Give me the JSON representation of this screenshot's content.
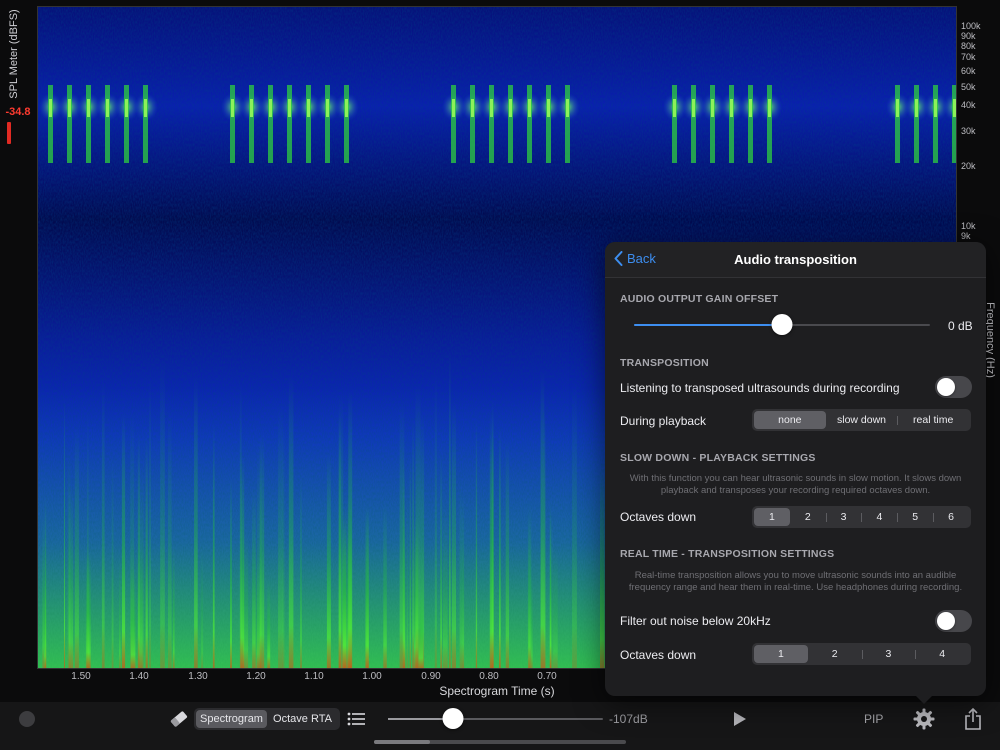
{
  "spl_meter": {
    "title": "SPL Meter (dBFS)",
    "value": "-34.8",
    "segments_total": 75,
    "segments_lit": 45,
    "lit_color": "#e12a23"
  },
  "spectrogram": {
    "frequency_axis": {
      "title": "Frequency (Hz)",
      "ticks": [
        "100k",
        "90k",
        "80k",
        "70k",
        "60k",
        "50k",
        "40k",
        "30k",
        "20k",
        "10k",
        "9k"
      ]
    },
    "time_axis": {
      "title": "Spectrogram Time (s)",
      "ticks": [
        "1.50",
        "1.40",
        "1.30",
        "1.20",
        "1.10",
        "1.00",
        "0.90",
        "0.80",
        "0.70"
      ]
    }
  },
  "toolbar": {
    "view_options": [
      "Spectrogram",
      "Octave RTA"
    ],
    "selected_view": "Spectrogram",
    "gain_value": "-107dB",
    "gain_level": 0.3,
    "pip_label": "PIP"
  },
  "popover": {
    "back_label": "Back",
    "title": "Audio transposition",
    "output_gain": {
      "header": "AUDIO OUTPUT GAIN OFFSET",
      "value": "0 dB",
      "level": 0.5
    },
    "transposition": {
      "header": "TRANSPOSITION",
      "listen_label": "Listening to transposed ultrasounds during recording",
      "listen_on": false,
      "playback_label": "During playback",
      "playback_options": [
        "none",
        "slow down",
        "real time"
      ],
      "playback_selected": "none"
    },
    "slow_down": {
      "header": "SLOW DOWN - PLAYBACK SETTINGS",
      "description": "With this function you can hear ultrasonic sounds in slow motion. It slows down playback and transposes your recording required octaves down.",
      "octaves_label": "Octaves down",
      "octaves_options": [
        "1",
        "2",
        "3",
        "4",
        "5",
        "6"
      ],
      "octaves_selected": "1"
    },
    "real_time": {
      "header": "REAL TIME - TRANSPOSITION SETTINGS",
      "description": "Real-time transposition allows you to move ultrasonic sounds into an audible frequency range and hear them in real-time. Use headphones during recording.",
      "filter_label": "Filter out noise below 20kHz",
      "filter_on": false,
      "octaves_label": "Octaves down",
      "octaves_options": [
        "1",
        "2",
        "3",
        "4"
      ],
      "octaves_selected": "1"
    }
  },
  "colors": {
    "accent": "#3d8ef0",
    "meter_red": "#e12a23",
    "spectrogram_low": "#0a1a9c",
    "spectrogram_mid": "#2ec83a",
    "spectrogram_high": "#c23b14"
  }
}
